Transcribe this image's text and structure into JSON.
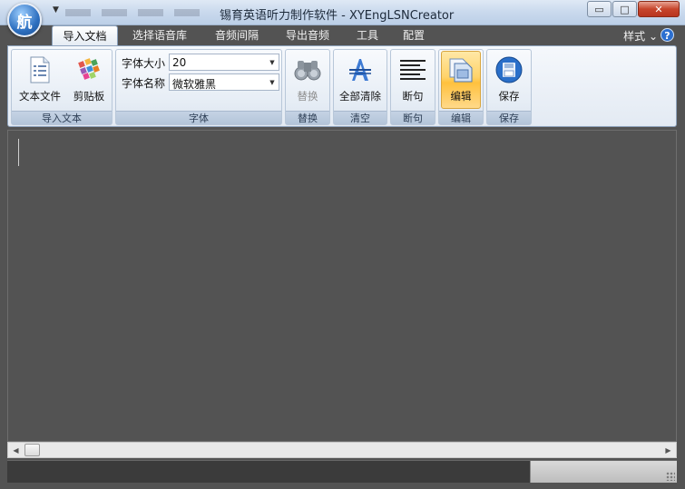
{
  "window": {
    "title": "锡育英语听力制作软件 - XYEngLSNCreator",
    "minimize": "▭",
    "maximize": "□",
    "close": "✕"
  },
  "app_orb": {
    "icon": "app-logo-icon",
    "glyph": "航"
  },
  "tabs": [
    {
      "label": "导入文档",
      "active": true
    },
    {
      "label": "选择语音库",
      "active": false
    },
    {
      "label": "音频间隔",
      "active": false
    },
    {
      "label": "导出音频",
      "active": false
    },
    {
      "label": "工具",
      "active": false
    },
    {
      "label": "配置",
      "active": false
    }
  ],
  "style_menu": "样式 ⌄",
  "help": "?",
  "ribbon": {
    "import_group": {
      "label": "导入文本",
      "text_file": "文本文件",
      "clipboard": "剪贴板"
    },
    "font_group": {
      "label": "字体",
      "size_label": "字体大小",
      "size_value": "20",
      "name_label": "字体名称",
      "name_value": "微软雅黑"
    },
    "replace_group": {
      "label": "替换",
      "button": "替换",
      "enabled": false
    },
    "clear_group": {
      "label": "清空",
      "button": "全部清除"
    },
    "split_group": {
      "label": "断句",
      "button": "断句"
    },
    "edit_group": {
      "label": "编辑",
      "button": "编辑",
      "active": true
    },
    "save_group": {
      "label": "保存",
      "button": "保存"
    }
  },
  "colors": {
    "background": "#535353",
    "ribbon": "#e3eaf3",
    "active_button": "#ffd36a",
    "close_button": "#c7452c"
  }
}
